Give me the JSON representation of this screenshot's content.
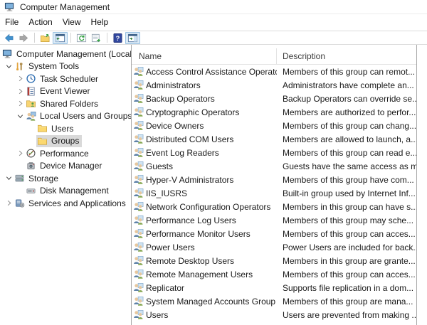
{
  "window": {
    "title": "Computer Management"
  },
  "menu": {
    "items": [
      "File",
      "Action",
      "View",
      "Help"
    ]
  },
  "toolbar": {
    "buttons": [
      {
        "icon": "back-arrow-icon",
        "active": false
      },
      {
        "icon": "forward-arrow-icon",
        "active": false
      },
      {
        "separator": true
      },
      {
        "icon": "up-one-level-icon",
        "active": false
      },
      {
        "icon": "show-console-tree-icon",
        "active": true
      },
      {
        "separator": true
      },
      {
        "icon": "refresh-icon",
        "active": false
      },
      {
        "icon": "export-list-icon",
        "active": false
      },
      {
        "separator": true
      },
      {
        "icon": "help-icon",
        "active": false
      },
      {
        "icon": "show-action-pane-icon",
        "active": true
      }
    ]
  },
  "tree": {
    "items": [
      {
        "label": "Computer Management (Local",
        "level": 0,
        "chevron": null,
        "icon": "computer-icon",
        "selected": false
      },
      {
        "label": "System Tools",
        "level": 1,
        "chevron": "expanded",
        "icon": "system-tools-icon",
        "selected": false
      },
      {
        "label": "Task Scheduler",
        "level": 2,
        "chevron": "collapsed",
        "icon": "task-scheduler-icon",
        "selected": false
      },
      {
        "label": "Event Viewer",
        "level": 2,
        "chevron": "collapsed",
        "icon": "event-viewer-icon",
        "selected": false
      },
      {
        "label": "Shared Folders",
        "level": 2,
        "chevron": "collapsed",
        "icon": "shared-folders-icon",
        "selected": false
      },
      {
        "label": "Local Users and Groups",
        "level": 2,
        "chevron": "expanded",
        "icon": "users-groups-icon",
        "selected": false
      },
      {
        "label": "Users",
        "level": 3,
        "chevron": null,
        "icon": "folder-icon",
        "selected": false
      },
      {
        "label": "Groups",
        "level": 3,
        "chevron": null,
        "icon": "folder-icon",
        "selected": true
      },
      {
        "label": "Performance",
        "level": 2,
        "chevron": "collapsed",
        "icon": "performance-icon",
        "selected": false
      },
      {
        "label": "Device Manager",
        "level": 2,
        "chevron": null,
        "icon": "device-manager-icon",
        "selected": false
      },
      {
        "label": "Storage",
        "level": 1,
        "chevron": "expanded",
        "icon": "storage-icon",
        "selected": false
      },
      {
        "label": "Disk Management",
        "level": 2,
        "chevron": null,
        "icon": "disk-management-icon",
        "selected": false
      },
      {
        "label": "Services and Applications",
        "level": 1,
        "chevron": "collapsed",
        "icon": "services-icon",
        "selected": false
      }
    ]
  },
  "list": {
    "columns": [
      "Name",
      "Description"
    ],
    "row_icon": "group-icon",
    "rows": [
      {
        "name": "Access Control Assistance Operators",
        "description": "Members of this group can remot..."
      },
      {
        "name": "Administrators",
        "description": "Administrators have complete an..."
      },
      {
        "name": "Backup Operators",
        "description": "Backup Operators can override se..."
      },
      {
        "name": "Cryptographic Operators",
        "description": "Members are authorized to perfor..."
      },
      {
        "name": "Device Owners",
        "description": "Members of this group can chang..."
      },
      {
        "name": "Distributed COM Users",
        "description": "Members are allowed to launch, a..."
      },
      {
        "name": "Event Log Readers",
        "description": "Members of this group can read e..."
      },
      {
        "name": "Guests",
        "description": "Guests have the same access as m..."
      },
      {
        "name": "Hyper-V Administrators",
        "description": "Members of this group have com..."
      },
      {
        "name": "IIS_IUSRS",
        "description": "Built-in group used by Internet Inf..."
      },
      {
        "name": "Network Configuration Operators",
        "description": "Members in this group can have s..."
      },
      {
        "name": "Performance Log Users",
        "description": "Members of this group may sche..."
      },
      {
        "name": "Performance Monitor Users",
        "description": "Members of this group can acces..."
      },
      {
        "name": "Power Users",
        "description": "Power Users are included for back..."
      },
      {
        "name": "Remote Desktop Users",
        "description": "Members in this group are grante..."
      },
      {
        "name": "Remote Management Users",
        "description": "Members of this group can acces..."
      },
      {
        "name": "Replicator",
        "description": "Supports file replication in a dom..."
      },
      {
        "name": "System Managed Accounts Group",
        "description": "Members of this group are mana..."
      },
      {
        "name": "Users",
        "description": "Users are prevented from making ..."
      }
    ]
  },
  "colors": {
    "selection_gray": "#d9d9d9",
    "toolbar_active_bg": "#dcebf7",
    "toolbar_active_border": "#98c1e2",
    "pane_divider": "#a6a6a6",
    "accent_blue": "#4292cf"
  }
}
